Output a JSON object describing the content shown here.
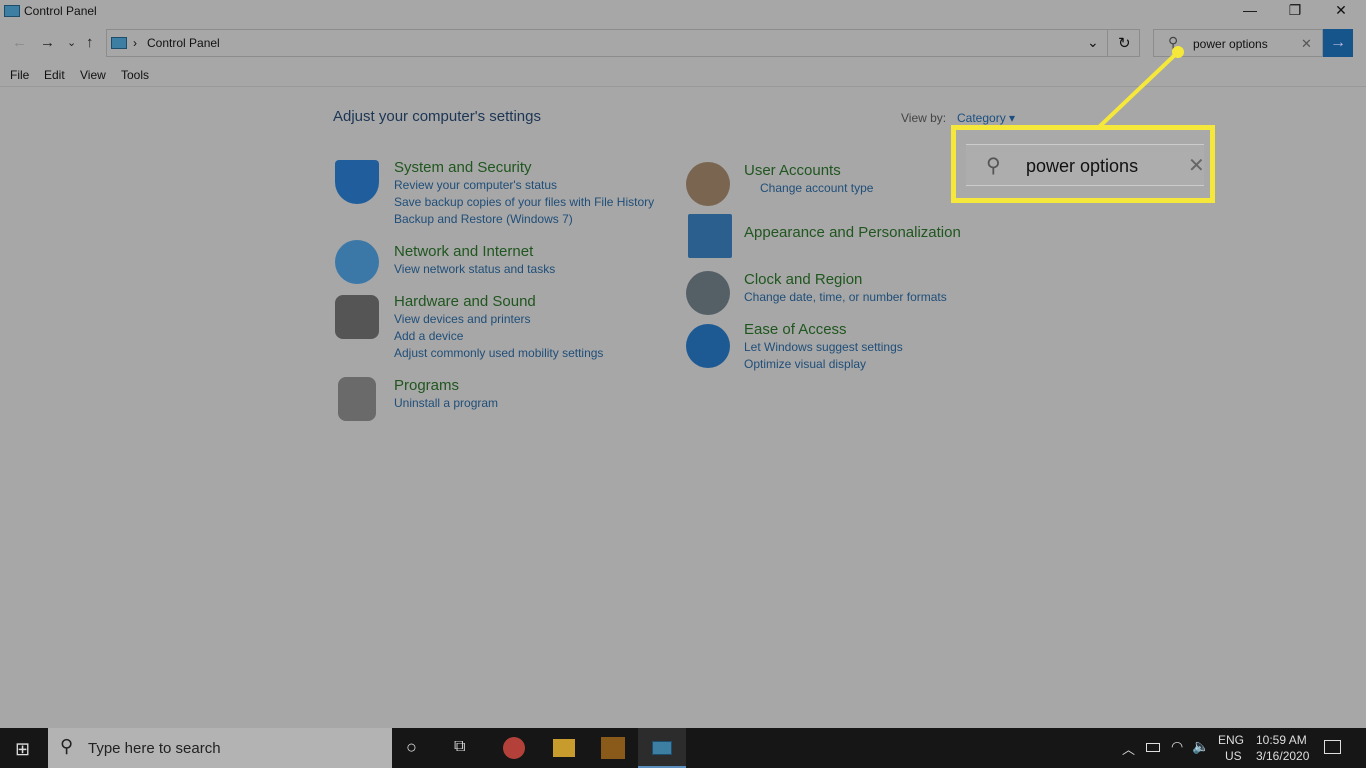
{
  "window": {
    "title": "Control Panel",
    "minimize": "—",
    "restore": "❐",
    "close": "✕"
  },
  "nav": {
    "back": "←",
    "forward": "→",
    "recent": "⌄",
    "up": "↑",
    "refresh": "↻",
    "dropdown": "⌄"
  },
  "address": {
    "separator": "›",
    "crumb": "Control Panel"
  },
  "search": {
    "value": "power options",
    "clear": "✕",
    "go": "→"
  },
  "menu": [
    "File",
    "Edit",
    "View",
    "Tools"
  ],
  "main": {
    "title": "Adjust your computer's settings",
    "view_by_label": "View by:",
    "view_by_value": "Category ▾"
  },
  "categories": [
    {
      "title": "System and Security",
      "links": [
        "Review your computer's status",
        "Save backup copies of your files with File History",
        "Backup and Restore (Windows 7)"
      ]
    },
    {
      "title": "Network and Internet",
      "links": [
        "View network status and tasks"
      ]
    },
    {
      "title": "Hardware and Sound",
      "links": [
        "View devices and printers",
        "Add a device",
        "Adjust commonly used mobility settings"
      ]
    },
    {
      "title": "Programs",
      "links": [
        "Uninstall a program"
      ]
    },
    {
      "title": "User Accounts",
      "links": [
        "Change account type"
      ]
    },
    {
      "title": "Appearance and Personalization",
      "links": []
    },
    {
      "title": "Clock and Region",
      "links": [
        "Change date, time, or number formats"
      ]
    },
    {
      "title": "Ease of Access",
      "links": [
        "Let Windows suggest settings",
        "Optimize visual display"
      ]
    }
  ],
  "callout": {
    "text": "power options",
    "color": "#f5e83a"
  },
  "taskbar": {
    "search_placeholder": "Type here to search",
    "lang1": "ENG",
    "lang2": "US",
    "time": "10:59 AM",
    "date": "3/16/2020"
  },
  "colors": {
    "accent": "#16548c",
    "heading": "#20561f",
    "link": "#1f4e79"
  }
}
